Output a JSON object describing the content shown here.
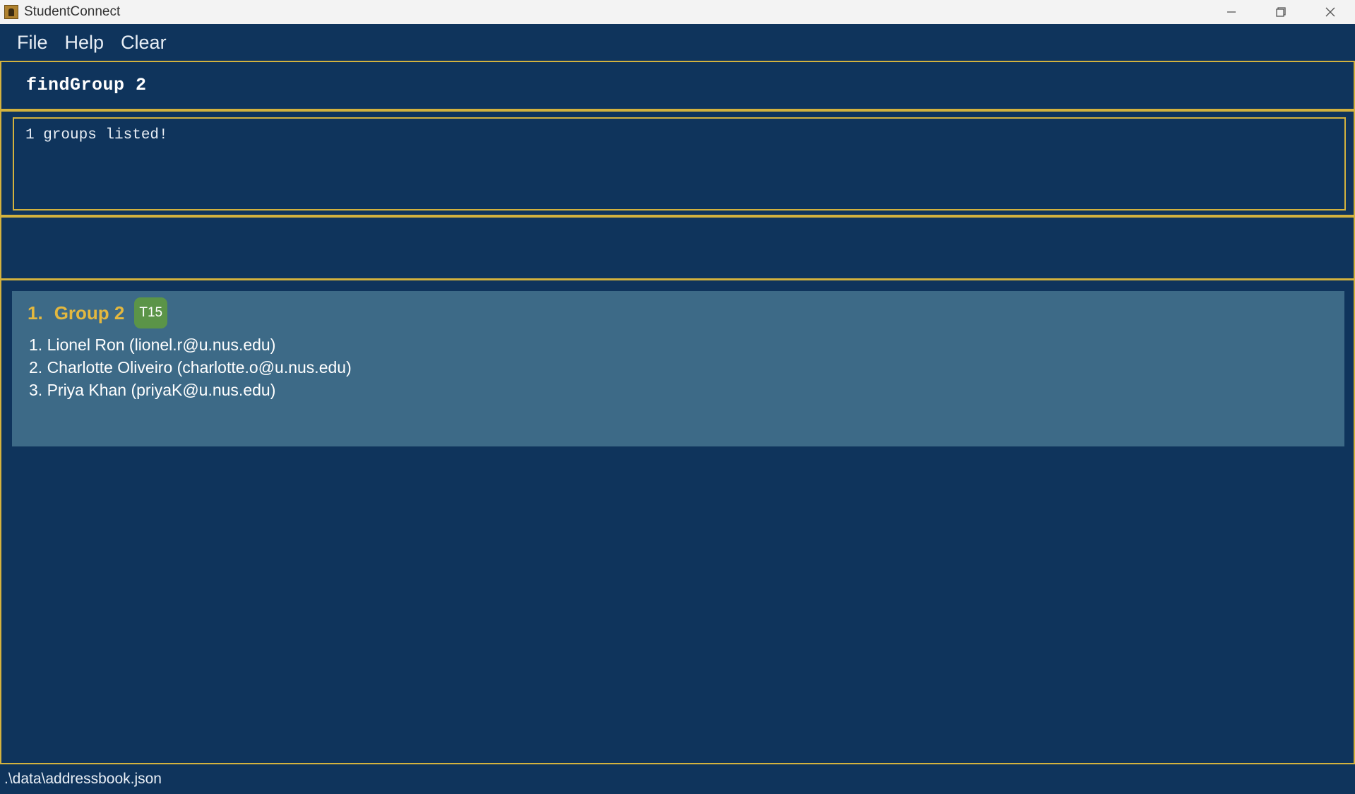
{
  "window": {
    "title": "StudentConnect",
    "icon": "app-icon"
  },
  "menu": {
    "file": "File",
    "help": "Help",
    "clear": "Clear"
  },
  "command": {
    "value": "findGroup 2"
  },
  "result": {
    "message": "1 groups listed!"
  },
  "groups": [
    {
      "index": "1.",
      "name": "Group 2",
      "tag": "T15",
      "members": [
        "1. Lionel Ron (lionel.r@u.nus.edu)",
        "2. Charlotte Oliveiro (charlotte.o@u.nus.edu)",
        "3. Priya Khan (priyaK@u.nus.edu)"
      ]
    }
  ],
  "status": {
    "path": ".\\data\\addressbook.json"
  },
  "colors": {
    "background": "#0f345c",
    "border": "#d3b23e",
    "card": "#3d6a87",
    "group_title": "#e3b83f",
    "tag": "#5b9448"
  }
}
